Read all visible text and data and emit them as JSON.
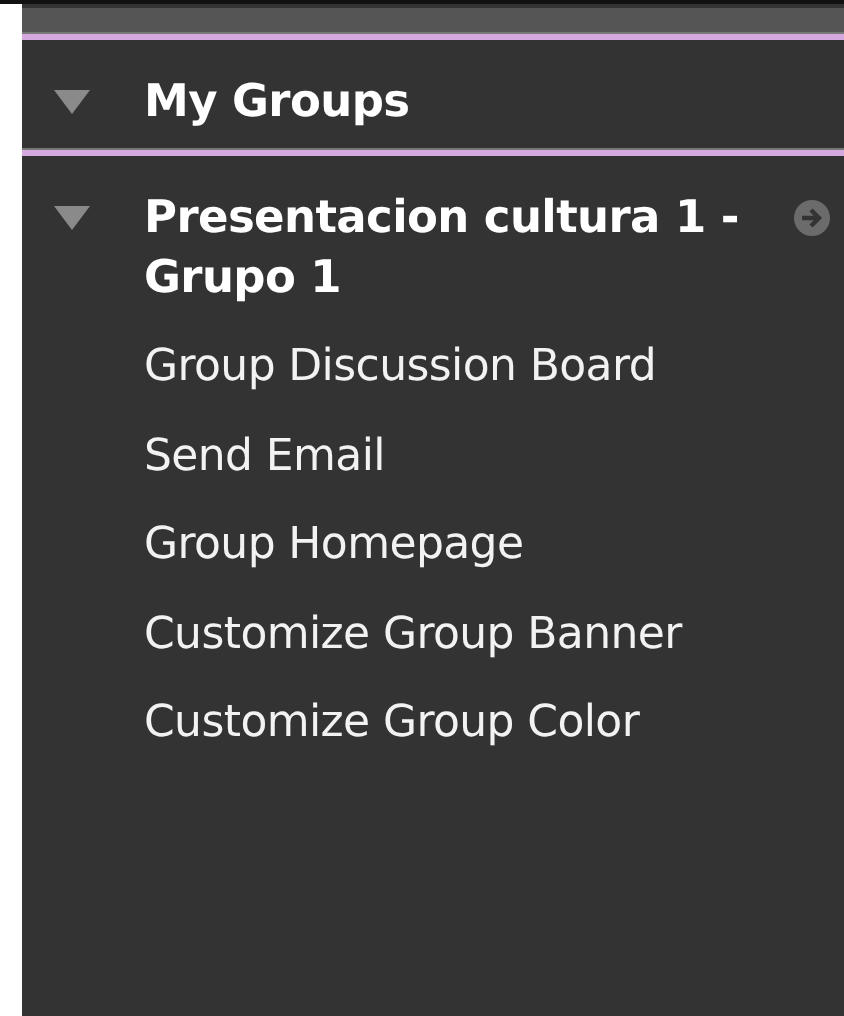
{
  "sections": [
    {
      "title": "My Groups",
      "expanded": true,
      "action_icon": false
    },
    {
      "title": "Presentacion cultura 1 - Grupo 1",
      "expanded": true,
      "action_icon": true,
      "items": [
        "Group Discussion Board",
        "Send Email",
        "Group Homepage",
        "Customize Group Banner",
        "Customize Group Color"
      ]
    }
  ]
}
